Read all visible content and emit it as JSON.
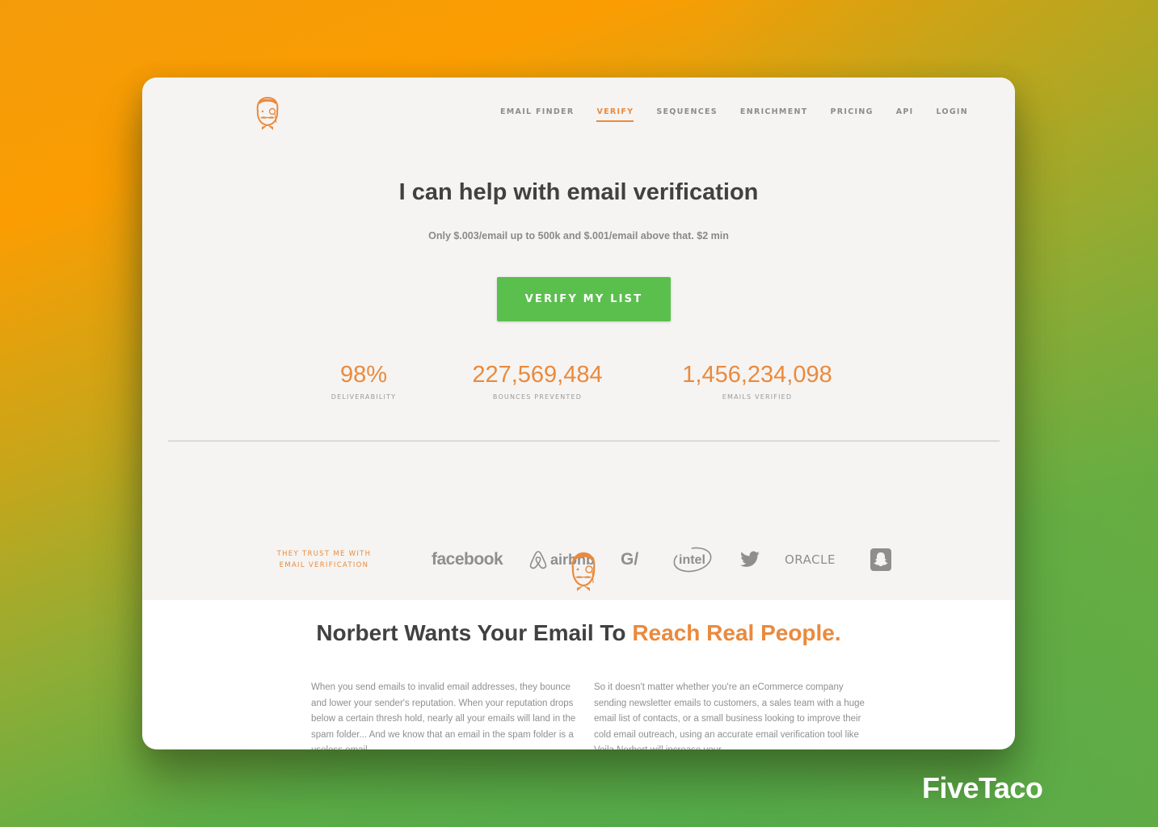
{
  "colors": {
    "accent": "#ea8a3d",
    "cta": "#5bbf4e",
    "headline": "#414141",
    "muted": "#8c8c8c"
  },
  "nav": {
    "logo_icon": "norbert-mascot-icon",
    "items": [
      {
        "label": "EMAIL FINDER",
        "active": false
      },
      {
        "label": "VERIFY",
        "active": true
      },
      {
        "label": "SEQUENCES",
        "active": false
      },
      {
        "label": "ENRICHMENT",
        "active": false
      },
      {
        "label": "PRICING",
        "active": false
      },
      {
        "label": "API",
        "active": false
      },
      {
        "label": "LOGIN",
        "active": false
      }
    ]
  },
  "hero": {
    "title": "I can help with email verification",
    "subtitle": "Only $.003/email up to 500k and $.001/email above that. $2 min",
    "cta_label": "VERIFY MY LIST"
  },
  "stats": [
    {
      "value": "98%",
      "label": "DELIVERABILITY"
    },
    {
      "value": "227,569,484",
      "label": "BOUNCES PREVENTED"
    },
    {
      "value": "1,456,234,098",
      "label": "EMAILS VERIFIED"
    }
  ],
  "trust": {
    "label_line1": "THEY TRUST ME WITH",
    "label_line2": "EMAIL VERIFICATION",
    "brands": [
      "facebook",
      "airbnb",
      "G/",
      "intel",
      "twitter",
      "ORACLE",
      "snapchat"
    ]
  },
  "section": {
    "mascot_icon": "norbert-mascot-icon",
    "title_plain": "Norbert Wants Your Email To ",
    "title_highlight": "Reach Real People.",
    "paragraph_left": "When you send emails to invalid email addresses, they bounce and lower your sender's reputation. When your reputation drops below a certain thresh hold, nearly all your emails will land in the spam folder... And we know that an email in the spam folder is a useless email.",
    "paragraph_right": "So it doesn't matter whether you're an eCommerce company sending newsletter emails to customers, a sales team with a huge email list of contacts, or a small business looking to improve their cold email outreach, using an accurate email verification tool like Voila Norbert will increase your"
  },
  "watermark": "FiveTaco"
}
